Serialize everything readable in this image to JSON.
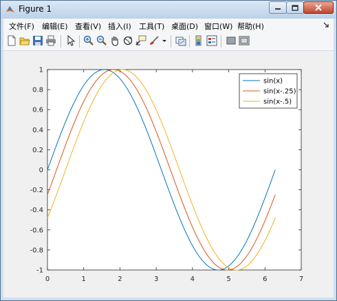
{
  "window": {
    "title": "Figure 1"
  },
  "menu": {
    "items": [
      {
        "label": "文件(F)"
      },
      {
        "label": "编辑(E)"
      },
      {
        "label": "查看(V)"
      },
      {
        "label": "插入(I)"
      },
      {
        "label": "工具(T)"
      },
      {
        "label": "桌面(D)"
      },
      {
        "label": "窗口(W)"
      },
      {
        "label": "帮助(H)"
      }
    ]
  },
  "toolbar": {
    "icons": [
      "new-figure-icon",
      "open-file-icon",
      "save-icon",
      "print-icon",
      "pointer-icon",
      "zoom-in-icon",
      "zoom-out-icon",
      "pan-icon",
      "rotate-icon",
      "data-cursor-icon",
      "brush-icon",
      "dropdown-arrow-icon",
      "link-plot-icon",
      "colorbar-icon",
      "legend-icon",
      "hide-plot-tools-icon",
      "show-plot-tools-icon"
    ]
  },
  "chart_data": {
    "type": "line",
    "xlim": [
      0,
      7
    ],
    "ylim": [
      -1,
      1
    ],
    "xticks": [
      "0",
      "1",
      "2",
      "3",
      "4",
      "5",
      "6",
      "7"
    ],
    "yticks": [
      "1",
      "0.8",
      "0.6",
      "0.4",
      "0.2",
      "0",
      "-0.2",
      "-0.4",
      "-0.6",
      "-0.8",
      "-1"
    ],
    "grid": false,
    "legend_position": "top-right",
    "series": [
      {
        "name": "sin(x)",
        "color": "#0072bd",
        "shift": 0
      },
      {
        "name": "sin(x-.25)",
        "color": "#d95319",
        "shift": 0.25
      },
      {
        "name": "sin(x-.5)",
        "color": "#edb120",
        "shift": 0.5
      }
    ],
    "x_range": [
      0,
      6.2832
    ]
  }
}
